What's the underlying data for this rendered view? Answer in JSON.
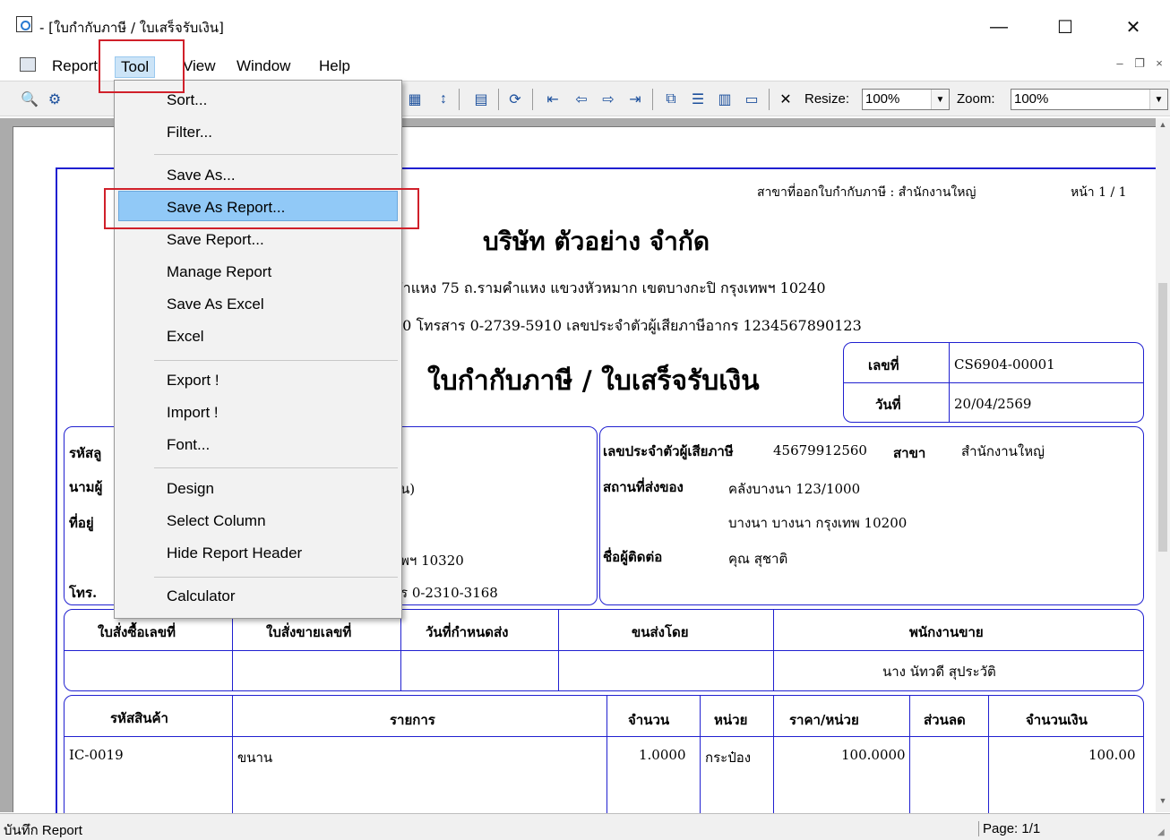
{
  "window": {
    "title": "- [ใบกำกับภาษี / ใบเสร็จรับเงิน]",
    "minimize": "—",
    "maximize": "☐",
    "close": "✕"
  },
  "menubar": {
    "items": [
      "Report",
      "Tool",
      "View",
      "Window",
      "Help"
    ],
    "active": "Tool",
    "mdi_min": "–",
    "mdi_restore": "❐",
    "mdi_close": "×"
  },
  "toolbar": {
    "resize_label": "Resize:",
    "resize_value": "100%",
    "zoom_label": "Zoom:",
    "zoom_value": "100%"
  },
  "tool_menu": {
    "items": [
      "Sort...",
      "Filter...",
      "Save As...",
      "Save As Report...",
      "Save Report...",
      "Manage Report",
      "Save As Excel",
      "Excel",
      "Export !",
      "Import !",
      "Font...",
      "Design",
      "Select Column",
      "Hide Report Header",
      "Calculator"
    ],
    "highlighted": "Save As Report..."
  },
  "report": {
    "branch_line": "สาขาที่ออกใบกำกับภาษี : สำนักงานใหญ่",
    "page_line": "หน้า 1 / 1",
    "company": "บริษัท ตัวอย่าง จำกัด",
    "address_partial": "คำแหง 75 ถ.รามคำแหง แขวงหัวหมาก เขตบางกะปิ กรุงเทพฯ 10240",
    "phone_partial": "00  โทรสาร 0-2739-5910  เลขประจำตัวผู้เสียภาษีอากร 1234567890123",
    "doc_title": "ใบกำกับภาษี / ใบเสร็จรับเงิน",
    "doc_no_label": "เลขที่",
    "doc_no": "CS6904-00001",
    "date_label": "วันที่",
    "date": "20/04/2569",
    "cust_code_label": "รหัสลู",
    "cust_name_label": "นามผู้",
    "cust_addr_label": "ที่อยู่",
    "cust_tel_label": "โทร.",
    "cust_name_tail": "น)",
    "cust_addr_tail": "พฯ 10320",
    "cust_tel_tail": "ร 0-2310-3168",
    "taxid_label": "เลขประจำตัวผู้เสียภาษี",
    "taxid": "45679912560",
    "branch_label": "สาขา",
    "branch": "สำนักงานใหญ่",
    "ship_label": "สถานที่ส่งของ",
    "ship_line1": "คลังบางนา 123/1000",
    "ship_line2": "บางนา บางนา กรุงเทพ 10200",
    "contact_label": "ชื่อผู้ติดต่อ",
    "contact": "คุณ สุชาติ",
    "header_cols": [
      "ใบสั่งซื้อเลขที่",
      "ใบสั่งขายเลขที่",
      "วันที่กำหนดส่ง",
      "ขนส่งโดย",
      "พนักงานขาย"
    ],
    "salesperson": "นาง นัทวดี สุประวัติ",
    "item_cols": [
      "รหัสสินค้า",
      "รายการ",
      "จำนวน",
      "หน่วย",
      "ราคา/หน่วย",
      "ส่วนลด",
      "จำนวนเงิน"
    ],
    "items": [
      [
        "IC-0019",
        "ขนาน",
        "1.0000",
        "กระป๋อง",
        "100.0000",
        "",
        "100.00"
      ]
    ]
  },
  "statusbar": {
    "left": "บันทึก Report",
    "right": "Page: 1/1"
  }
}
